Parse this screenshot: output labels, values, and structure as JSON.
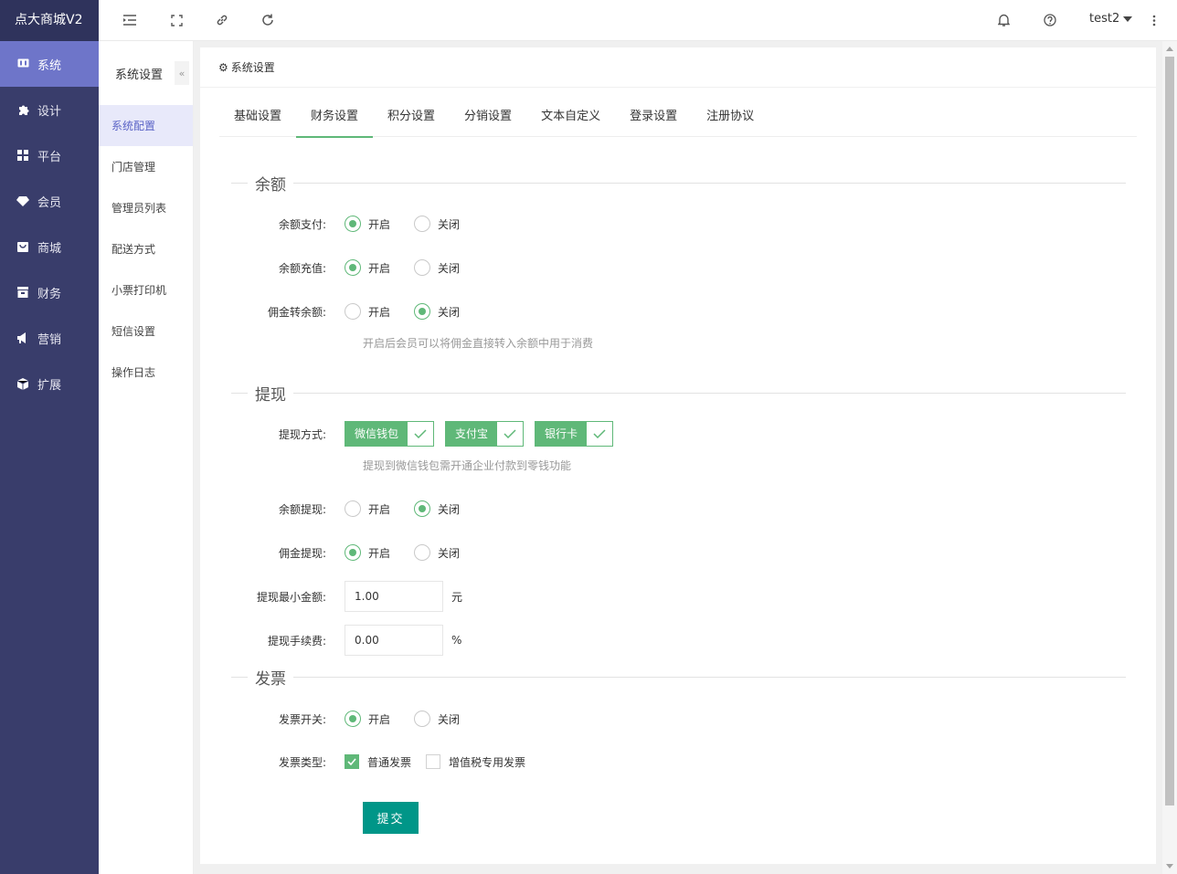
{
  "app": {
    "title": "点大商城V2"
  },
  "sidebar": {
    "items": [
      {
        "label": "系统",
        "icon": "monitor-icon",
        "active": true
      },
      {
        "label": "设计",
        "icon": "puzzle-icon",
        "active": false
      },
      {
        "label": "平台",
        "icon": "grid-icon",
        "active": false
      },
      {
        "label": "会员",
        "icon": "diamond-icon",
        "active": false
      },
      {
        "label": "商城",
        "icon": "shop-icon",
        "active": false
      },
      {
        "label": "财务",
        "icon": "wallet-icon",
        "active": false
      },
      {
        "label": "营销",
        "icon": "megaphone-icon",
        "active": false
      },
      {
        "label": "扩展",
        "icon": "cube-icon",
        "active": false
      }
    ]
  },
  "topbar": {
    "user": "test2"
  },
  "subnav": {
    "title": "系统设置",
    "items": [
      {
        "label": "系统配置",
        "active": true
      },
      {
        "label": "门店管理",
        "active": false
      },
      {
        "label": "管理员列表",
        "active": false
      },
      {
        "label": "配送方式",
        "active": false
      },
      {
        "label": "小票打印机",
        "active": false
      },
      {
        "label": "短信设置",
        "active": false
      },
      {
        "label": "操作日志",
        "active": false
      }
    ]
  },
  "card": {
    "title": "系统设置"
  },
  "tabs": [
    {
      "label": "基础设置",
      "active": false
    },
    {
      "label": "财务设置",
      "active": true
    },
    {
      "label": "积分设置",
      "active": false
    },
    {
      "label": "分销设置",
      "active": false
    },
    {
      "label": "文本自定义",
      "active": false
    },
    {
      "label": "登录设置",
      "active": false
    },
    {
      "label": "注册协议",
      "active": false
    }
  ],
  "labels": {
    "on": "开启",
    "off": "关闭"
  },
  "balance": {
    "title": "余额",
    "pay": {
      "label": "余额支付:",
      "value": "on"
    },
    "recharge": {
      "label": "余额充值:",
      "value": "on"
    },
    "commission_to_balance": {
      "label": "佣金转余额:",
      "value": "off"
    },
    "hint": "开启后会员可以将佣金直接转入余额中用于消费"
  },
  "withdraw": {
    "title": "提现",
    "methods_label": "提现方式:",
    "methods": [
      "微信钱包",
      "支付宝",
      "银行卡"
    ],
    "methods_hint": "提现到微信钱包需开通企业付款到零钱功能",
    "balance_withdraw": {
      "label": "余额提现:",
      "value": "off"
    },
    "commission_withdraw": {
      "label": "佣金提现:",
      "value": "on"
    },
    "min_amount": {
      "label": "提现最小金额:",
      "value": "1.00",
      "unit": "元"
    },
    "fee": {
      "label": "提现手续费:",
      "value": "0.00",
      "unit": "%"
    }
  },
  "invoice": {
    "title": "发票",
    "switch": {
      "label": "发票开关:",
      "value": "on"
    },
    "type_label": "发票类型:",
    "types": [
      {
        "label": "普通发票",
        "checked": true
      },
      {
        "label": "增值税专用发票",
        "checked": false
      }
    ]
  },
  "submit_label": "提交",
  "colors": {
    "accent": "#5fb878",
    "primary": "#009688",
    "sidebar": "#393d6b",
    "sidebar_active": "#6e75c9"
  }
}
